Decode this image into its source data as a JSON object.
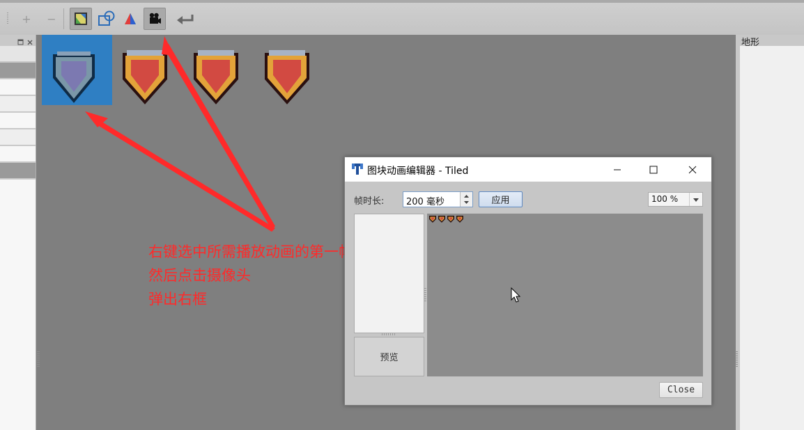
{
  "toolbar": {
    "buttons": [
      {
        "name": "add-frame",
        "symbol": "+"
      },
      {
        "name": "remove-frame",
        "symbol": "−"
      },
      {
        "name": "terrain-tool",
        "icon": "terrain-icon"
      },
      {
        "name": "collision-tool",
        "icon": "collision-shapes-icon"
      },
      {
        "name": "color-tool",
        "icon": "color-triangle-icon"
      },
      {
        "name": "animation-editor",
        "icon": "camera-icon"
      },
      {
        "name": "undo",
        "icon": "undo-arrow-icon"
      }
    ]
  },
  "right_dock": {
    "title": "地形"
  },
  "annotation": {
    "line1": "右键选中所需播放动画的第一帧",
    "line2": "然后点击摄像头",
    "line3": "弹出右框",
    "color": "#ff2a2a"
  },
  "dialog": {
    "title": "图块动画编辑器 - Tiled",
    "frame_duration_label": "帧时长:",
    "frame_duration_value": "200 毫秒",
    "apply_label": "应用",
    "zoom_value": "100 %",
    "preview_label": "预览",
    "close_label": "Close"
  },
  "colors": {
    "selection": "#2f7fc3",
    "arrow": "#ff2a2a",
    "shield_red": "#d24a42",
    "shield_gold": "#e3a33a"
  }
}
